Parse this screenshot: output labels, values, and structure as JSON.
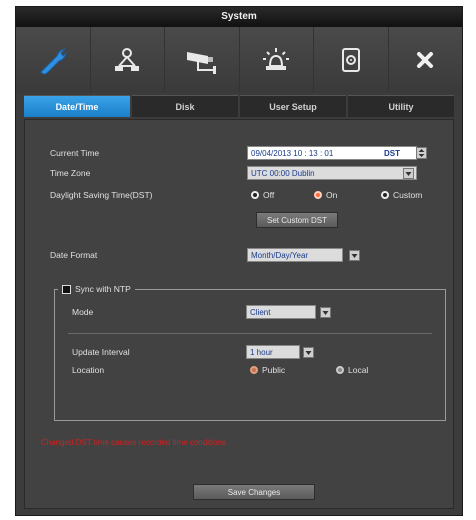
{
  "window": {
    "title": "System"
  },
  "iconbar": {
    "icons": [
      "wrench-icon",
      "network-icon",
      "camera-icon",
      "alarm-icon",
      "disk-icon",
      "close-icon"
    ]
  },
  "tabs": [
    {
      "label": "Date/Time",
      "active": true
    },
    {
      "label": "Disk",
      "active": false
    },
    {
      "label": "User Setup",
      "active": false
    },
    {
      "label": "Utility",
      "active": false
    }
  ],
  "form": {
    "current_time_label": "Current Time",
    "current_time_value": "09/04/2013  10 : 13 : 01",
    "dst_badge": "DST",
    "time_zone_label": "Time Zone",
    "time_zone_value": "UTC 00:00 Dublin",
    "dst_label": "Daylight Saving Time(DST)",
    "dst_options": [
      {
        "label": "Off",
        "selected": false
      },
      {
        "label": "On",
        "selected": true
      },
      {
        "label": "Custom",
        "selected": false
      }
    ],
    "set_custom_dst_label": "Set Custom DST",
    "date_format_label": "Date Format",
    "date_format_value": "Month/Day/Year"
  },
  "ntp": {
    "checkbox_label": "Sync with NTP",
    "checked": false,
    "mode_label": "Mode",
    "mode_value": "Client",
    "update_interval_label": "Update Interval",
    "update_interval_value": "1 hour",
    "location_label": "Location",
    "location_options": [
      {
        "label": "Public",
        "selected": true
      },
      {
        "label": "Local",
        "selected": false
      }
    ]
  },
  "warning_text": "Changed DST time causes recorded time conditions",
  "save_label": "Save Changes",
  "colors": {
    "accent": "#1a7fc8",
    "warning": "#cc2222",
    "radio_on": "#ff6a3a"
  }
}
